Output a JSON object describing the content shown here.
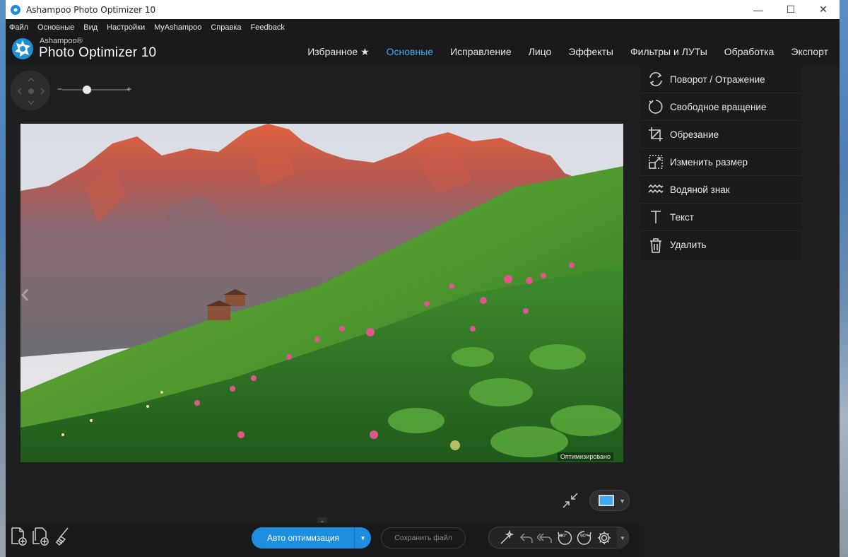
{
  "window": {
    "title": "Ashampoo Photo Optimizer 10",
    "minimize": "—",
    "maximize": "☐",
    "close": "✕"
  },
  "menu": [
    "Файл",
    "Основные",
    "Вид",
    "Настройки",
    "MyAshampoo",
    "Справка",
    "Feedback"
  ],
  "brand": {
    "small": "Ashampoo®",
    "big": "Photo Optimizer 10"
  },
  "tabs": [
    {
      "label": "Избранное ★",
      "active": false
    },
    {
      "label": "Основные",
      "active": true
    },
    {
      "label": "Исправление",
      "active": false
    },
    {
      "label": "Лицо",
      "active": false
    },
    {
      "label": "Эффекты",
      "active": false
    },
    {
      "label": "Фильтры и ЛУТы",
      "active": false
    },
    {
      "label": "Обработка",
      "active": false
    },
    {
      "label": "Экспорт",
      "active": false
    }
  ],
  "zoom": {
    "minus": "−",
    "plus": "+",
    "level": 0.37
  },
  "photo": {
    "status_label": "Оптимизировано"
  },
  "tools": [
    {
      "label": "Поворот / Отражение",
      "icon": "rotate-flip-icon"
    },
    {
      "label": "Свободное вращение",
      "icon": "free-rotate-icon"
    },
    {
      "label": "Обрезание",
      "icon": "crop-icon"
    },
    {
      "label": "Изменить размер",
      "icon": "resize-icon"
    },
    {
      "label": "Водяной знак",
      "icon": "watermark-icon"
    },
    {
      "label": "Текст",
      "icon": "text-icon"
    },
    {
      "label": "Удалить",
      "icon": "trash-icon"
    }
  ],
  "bottom": {
    "auto_optimize": "Авто оптимизация",
    "save_file": "Сохранить файл",
    "rotate_left_label": "90°",
    "rotate_right_label": "90°"
  },
  "colors": {
    "accent": "#3fa9f5",
    "button_blue": "#1e8fe0",
    "background": "#1f1f21"
  }
}
